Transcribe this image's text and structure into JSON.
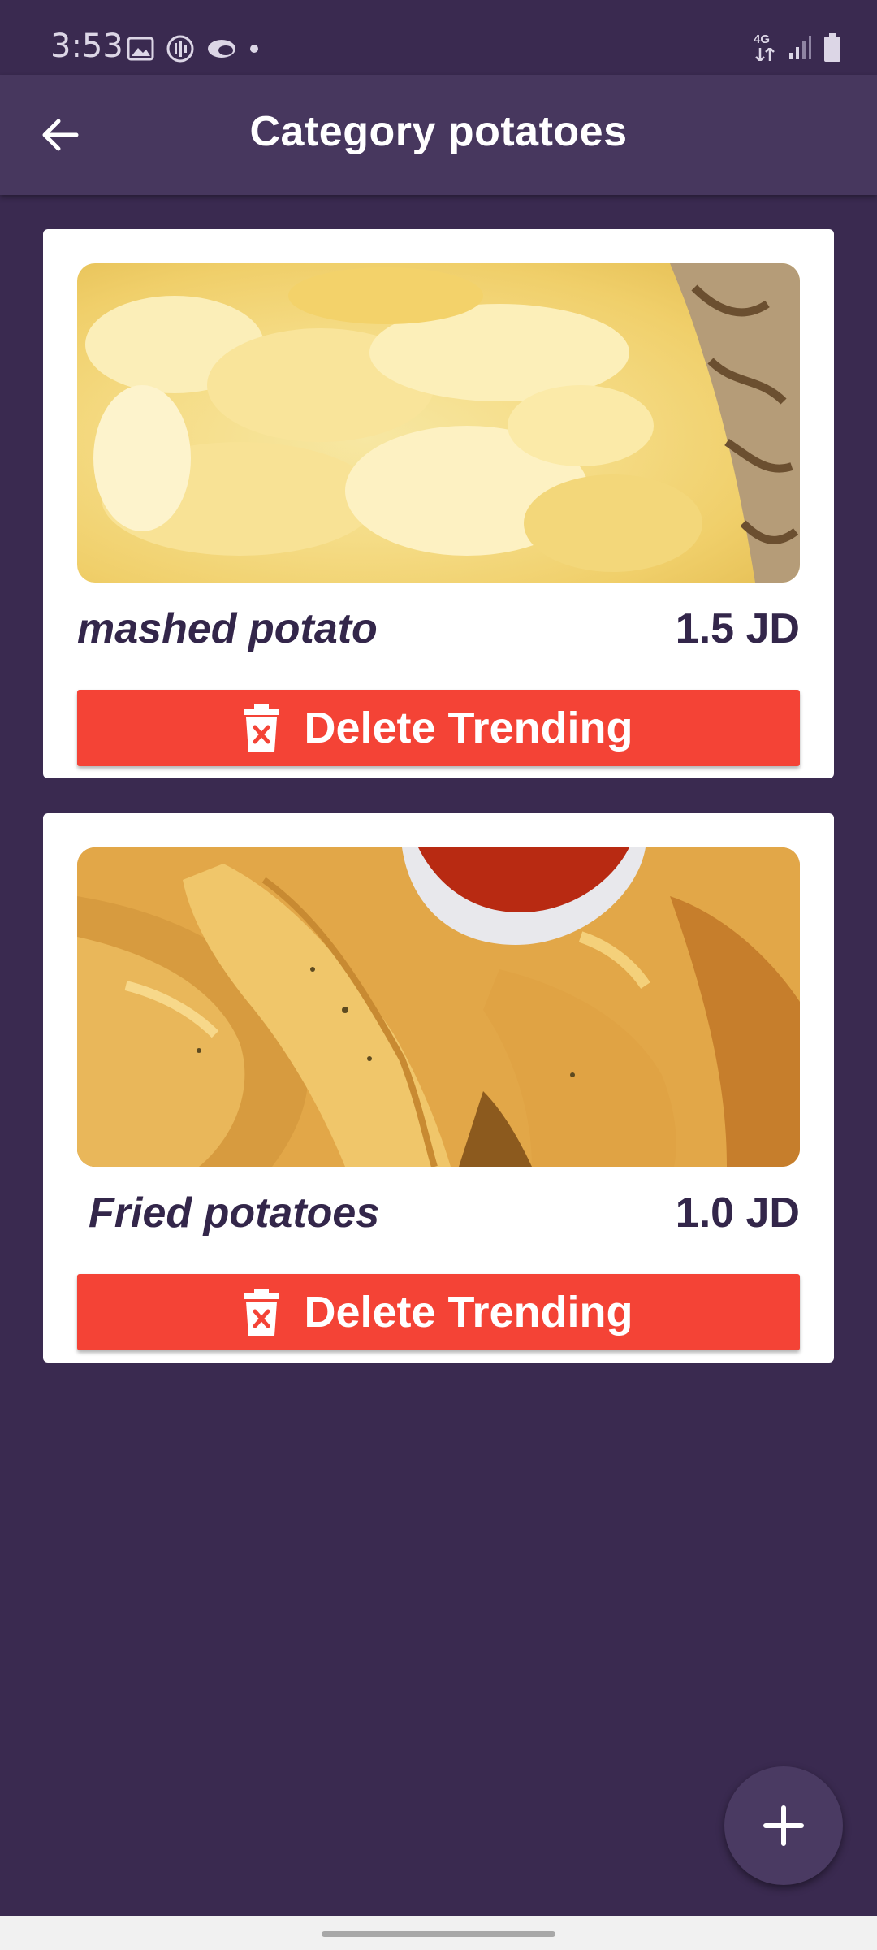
{
  "status_bar": {
    "time": "3:53",
    "left_icons": [
      "gallery-icon",
      "podcast-icon",
      "cloud-icon",
      "dot-icon"
    ],
    "network_label": "4G",
    "right_icons": [
      "network-4g-icon",
      "signal-icon",
      "battery-icon"
    ]
  },
  "app_bar": {
    "title": "Category potatoes",
    "back_icon": "arrow-back-icon"
  },
  "items": [
    {
      "name": "mashed potato",
      "price": "1.5 JD",
      "image": "mashed potato photo",
      "delete_label": "Delete Trending"
    },
    {
      "name": "Fried potatoes",
      "price": "1.0 JD",
      "image": "fried potatoes photo",
      "delete_label": "Delete Trending"
    }
  ],
  "fab": {
    "icon": "plus-icon"
  },
  "colors": {
    "background": "#3a2a50",
    "app_bar": "#47375e",
    "card": "#ffffff",
    "text_dark": "#33264a",
    "delete_button": "#f44336",
    "fab": "#4a3a62"
  }
}
